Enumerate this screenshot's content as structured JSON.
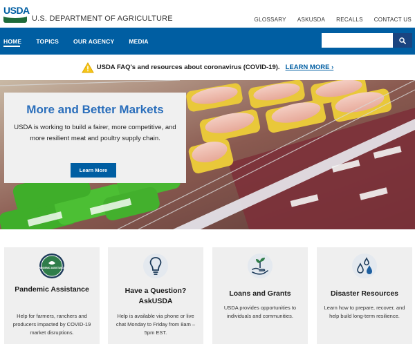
{
  "header": {
    "logo_text": "USDA",
    "dept_name": "U.S. DEPARTMENT OF AGRICULTURE",
    "util_links": [
      "GLOSSARY",
      "ASKUSDA",
      "RECALLS",
      "CONTACT US"
    ]
  },
  "nav": {
    "items": [
      "HOME",
      "TOPICS",
      "OUR AGENCY",
      "MEDIA"
    ],
    "active": "HOME"
  },
  "search": {
    "placeholder": "",
    "button_icon": "search-icon"
  },
  "alert": {
    "text": "USDA FAQ's and resources about coronavirus (COVID-19).",
    "link": "LEARN MORE ›",
    "icon": "warning-icon"
  },
  "hero": {
    "title": "More and Better Markets",
    "body": "USDA is working to build a fairer, more competitive, and more resilient meat and poultry supply chain.",
    "button": "Learn More"
  },
  "cards": [
    {
      "title": "Pandemic Assistance",
      "badge_text": "PANDEMIC ASSISTANCE",
      "desc": "Help for farmers, ranchers and producers impacted by COVID-19 market disruptions.",
      "icon": "pandemic-badge-icon"
    },
    {
      "title": "Have a Question? AskUSDA",
      "desc": "Help is available via phone or live chat Monday to Friday from 8am – 5pm EST.",
      "icon": "lightbulb-icon"
    },
    {
      "title": "Loans and Grants",
      "desc": "USDA provides opportunities to individuals and communities.",
      "icon": "hand-plant-icon"
    },
    {
      "title": "Disaster Resources",
      "desc": "Learn how to prepare, recover, and help build long-term resilience.",
      "icon": "water-drops-icon"
    }
  ],
  "colors": {
    "primary": "#005ea2",
    "alert_icon": "#f5c518",
    "hero_title": "#2a6ebb",
    "logo_green": "#1e6b3a"
  }
}
